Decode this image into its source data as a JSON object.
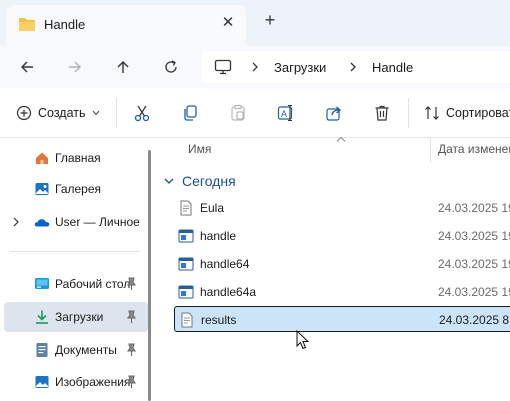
{
  "window": {
    "tab_title": "Handle",
    "tab_icon": "folder-icon",
    "colors": {
      "tabstrip_bg": "#eef3f9",
      "accent": "#0a64c8",
      "selection": "#cce4f7",
      "folder": "#f5c244"
    }
  },
  "address_bar": {
    "icon": "monitor-icon",
    "breadcrumbs": [
      "Загрузки",
      "Handle"
    ]
  },
  "toolbar": {
    "new_label": "Создать",
    "sort_label": "Сортировать",
    "icons": [
      "cut-icon",
      "copy-icon",
      "paste-icon",
      "rename-icon",
      "share-icon",
      "delete-icon"
    ]
  },
  "sidebar": {
    "items": [
      {
        "label": "Главная",
        "icon": "home-icon",
        "pinned": false
      },
      {
        "label": "Галерея",
        "icon": "gallery-icon",
        "pinned": false
      },
      {
        "label": "User — Личное",
        "icon": "onedrive-icon",
        "pinned": false,
        "expandable": true
      },
      {
        "label": "Рабочий стол",
        "icon": "desktop-icon",
        "pinned": true
      },
      {
        "label": "Загрузки",
        "icon": "download-icon",
        "pinned": true,
        "selected": true
      },
      {
        "label": "Документы",
        "icon": "documents-icon",
        "pinned": true
      },
      {
        "label": "Изображения",
        "icon": "pictures-icon",
        "pinned": true
      }
    ]
  },
  "file_list": {
    "columns": {
      "name": "Имя",
      "date": "Дата изменения"
    },
    "group": "Сегодня",
    "files": [
      {
        "name": "Eula",
        "date": "24.03.2025 19:",
        "icon": "text-file-icon"
      },
      {
        "name": "handle",
        "date": "24.03.2025 19:",
        "icon": "executable-icon"
      },
      {
        "name": "handle64",
        "date": "24.03.2025 19:",
        "icon": "executable-icon"
      },
      {
        "name": "handle64a",
        "date": "24.03.2025 19:",
        "icon": "executable-icon"
      },
      {
        "name": "results",
        "date": "24.03.2025 8:5",
        "icon": "text-file-icon",
        "selected": true
      }
    ]
  }
}
